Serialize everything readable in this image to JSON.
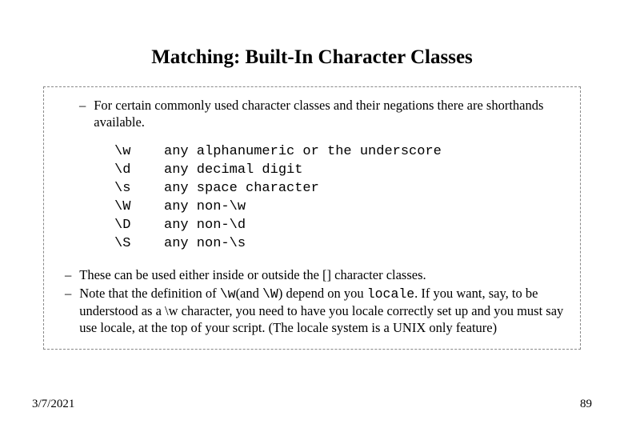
{
  "title": "Matching: Built-In Character Classes",
  "intro_dash": "–",
  "intro_text": "For certain commonly used character classes and their negations there are shorthands available.",
  "table": [
    {
      "code": "\\w",
      "desc": "any alphanumeric or the underscore"
    },
    {
      "code": "\\d",
      "desc": "any decimal digit"
    },
    {
      "code": "\\s",
      "desc": "any space character"
    },
    {
      "code": "\\W",
      "desc": "any non-\\w"
    },
    {
      "code": "\\D",
      "desc": "any non-\\d"
    },
    {
      "code": "\\S",
      "desc": "any non-\\s"
    }
  ],
  "notes": {
    "dash": "–",
    "n1": "These can be used either inside or outside the [] character classes.",
    "n2_a": "Note that the definition of ",
    "n2_code1": "\\w",
    "n2_b": "(and ",
    "n2_code2": "\\W",
    "n2_c": ") depend on you ",
    "n2_code3": "locale",
    "n2_d": ". If you want, say, to be understood as a \\w character, you need to have you locale correctly set up and you must say use locale, at the top of your script. (The locale system is a UNIX only feature)"
  },
  "footer": {
    "date": "3/7/2021",
    "page": "89"
  }
}
